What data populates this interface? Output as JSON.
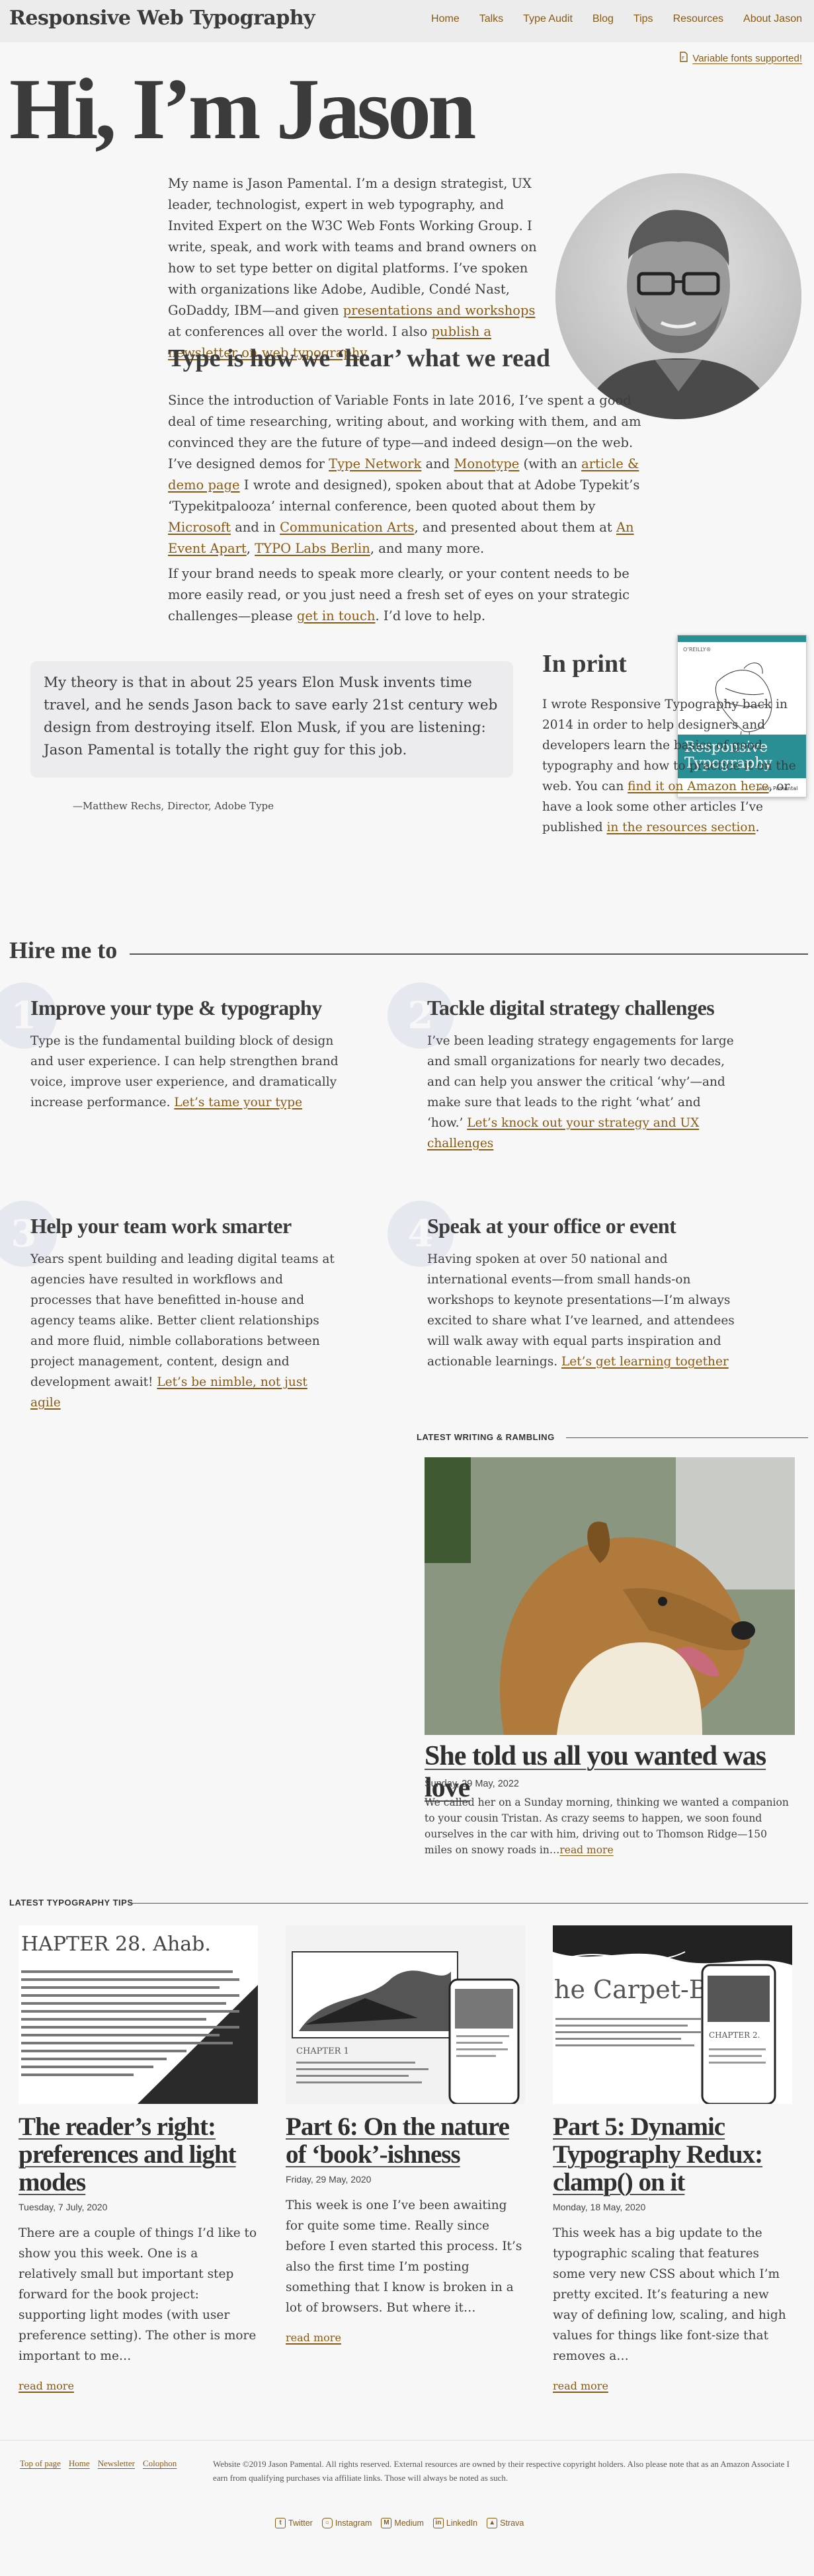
{
  "header": {
    "site_title": "Responsive Web Typography",
    "nav": [
      "Home",
      "Talks",
      "Type Audit",
      "Blog",
      "Tips",
      "Resources",
      "About Jason"
    ],
    "vf_badge": "Variable fonts supported!"
  },
  "hero": {
    "title": "Hi, I’m Jason",
    "intro": {
      "t1": "My name is Jason Pamental. I’m a design strategist, UX leader, technologist, expert in web typography, and Invited Expert on the W3C Web Fonts Working Group. I write, speak, and work with teams and brand owners on how to set type better on digital platforms. I’ve spoken with organizations like Adobe, Audible, Condé Nast, GoDaddy, IBM—and given ",
      "l1": "presentations and workshops",
      "t2": " at conferences all over the world. I also ",
      "l2": "publish a newsletter on web typography",
      "t3": "."
    },
    "type_heading": "Type is how we ‘hear’ what we read",
    "type_p": {
      "t1": "Since the introduction of Variable Fonts in late 2016, I’ve spent a good deal of time researching, writing about, and  working with them, and am convinced they are the future of type—and indeed design—on the web. I’ve designed demos for ",
      "l1": "Type Network",
      "t2": " and ",
      "l2": "Monotype",
      "t3": " (with an ",
      "l3": "article & demo page",
      "t4": " I wrote and designed), spoken about that at Adobe Typekit’s ‘Typekitpalooza’ internal conference, been quoted about them by ",
      "l4": "Microsoft",
      "t5": " and in ",
      "l5": "Communication Arts",
      "t6": ", and presented about them at ",
      "l6": "An Event Apart",
      "t7": ", ",
      "l7": "TYPO Labs Berlin",
      "t8": ", and many more."
    },
    "contact_p": {
      "t1": "If your brand needs to speak more clearly, or your content needs to be more easily read, or you just need a fresh set of eyes on your strategic challenges—please ",
      "l1": "get in touch",
      "t2": ". I’d love to help."
    }
  },
  "quote": {
    "text": "My theory is that in about 25 years Elon Musk invents time travel, and he sends Jason back to save early 21st century web design from destroying itself. Elon Musk, if you are listening: Jason Pamental is totally the right guy for this job.",
    "attribution": "—Matthew Rechs, Director, Adobe Type"
  },
  "print": {
    "heading": "In print",
    "t1": "I wrote Responsive Typography back in 2014 in order to help designers and developers learn the basics of good typography and how to practice it on the web. You can ",
    "l1": "find it on Amazon here",
    "t2": ", or have a look some other articles I’ve published ",
    "l2": "in the resources section",
    "t3": ".",
    "book_publisher": "O’REILLY®",
    "book_title_1": "Responsive",
    "book_title_2": "Typography",
    "book_author": "Jason Pamental"
  },
  "hire": {
    "heading": "Hire me to",
    "services": [
      {
        "num": "1",
        "title": "Improve your type & typography",
        "text": "Type is the fundamental building block of design and user experience. I can help strengthen brand voice, improve user experience, and dramatically increase performance. ",
        "link": "Let’s tame your type"
      },
      {
        "num": "2",
        "title": "Tackle digital strategy challenges",
        "text": "I’ve been leading strategy engagements for large and small organizations for nearly two decades, and can help you answer the critical ‘why’—and make sure that leads to the right ‘what’ and ‘how.’ ",
        "link": "Let’s knock out your strategy and UX challenges"
      },
      {
        "num": "3",
        "title": "Help your team work smarter",
        "text": "Years spent building and leading digital teams at agencies have resulted in workflows and processes that have benefitted in-house and agency teams alike. Better client relationships and more fluid, nimble collaborations between project management, content, design and development await! ",
        "link": "Let’s be nimble, not just agile"
      },
      {
        "num": "4",
        "title": "Speak at your office or event",
        "text": "Having spoken at over 50 national and international events—from small hands-on workshops to keynote presentations—I’m always excited to share what I’ve learned, and attendees will walk away with equal parts inspiration and actionable learnings. ",
        "link": "Let’s get learning together"
      }
    ]
  },
  "writing": {
    "label": "LATEST WRITING & RAMBLING",
    "title": "She told us all you wanted was love",
    "date": "Sunday, 29 May, 2022",
    "excerpt": "We called her on a Sunday morning, thinking we wanted a companion to your cousin Tristan. As crazy seems to happen, we soon found ourselves in the car with him, driving out to Thomson Ridge—150 miles on snowy roads in…",
    "more": "read more"
  },
  "tips": {
    "label": "LATEST TYPOGRAPHY TIPS",
    "items": [
      {
        "title": "The reader’s right: preferences and light modes",
        "date": "Tuesday, 7 July, 2020",
        "excerpt": "There are a couple of things I’d like to show you this week. One is a relatively small but important step forward for the book project: supporting light modes (with user preference setting). The other is more important to me…",
        "more": "read more",
        "img_heading": "HAPTER 28. Ahab."
      },
      {
        "title": "Part 6: On the nature of ‘book’-ishness",
        "date": "Friday, 29 May, 2020",
        "excerpt": "This week is one I’ve been awaiting for quite some time. Really since before I even started this process. It’s also the first time I’m posting something that I know is broken in a lot of browsers. But where it…",
        "more": "read more",
        "img_heading": "CHAPTER 1"
      },
      {
        "title": "Part 5: Dynamic Typography Redux: clamp() on it",
        "date": "Monday, 18 May, 2020",
        "excerpt": "This week has a big update to the typographic scaling that features some very new CSS about which I’m pretty excited. It’s featuring a new way of defining low, scaling, and high values for things like font-size that removes a…",
        "more": "read more",
        "img_heading": "he Carpet-Bag."
      }
    ]
  },
  "footer": {
    "links": [
      "Top of page",
      "Home",
      "Newsletter",
      "Colophon"
    ],
    "legal": "Website ©2019 Jason Pamental. All rights reserved. External resources are owned by their respective copyright holders. Also please note that as an Amazon Associate I earn from qualifying purchases via affiliate links. Those will always be noted as such.",
    "social": [
      {
        "label": "Twitter",
        "icon": "twitter-icon"
      },
      {
        "label": "Instagram",
        "icon": "instagram-icon"
      },
      {
        "label": "Medium",
        "icon": "medium-icon"
      },
      {
        "label": "LinkedIn",
        "icon": "linkedin-icon"
      },
      {
        "label": "Strava",
        "icon": "strava-icon"
      }
    ]
  },
  "colors": {
    "link": "#8a5a12",
    "text": "#3a3a3a",
    "background": "#f7f7f7",
    "header_bg": "#ececec"
  }
}
